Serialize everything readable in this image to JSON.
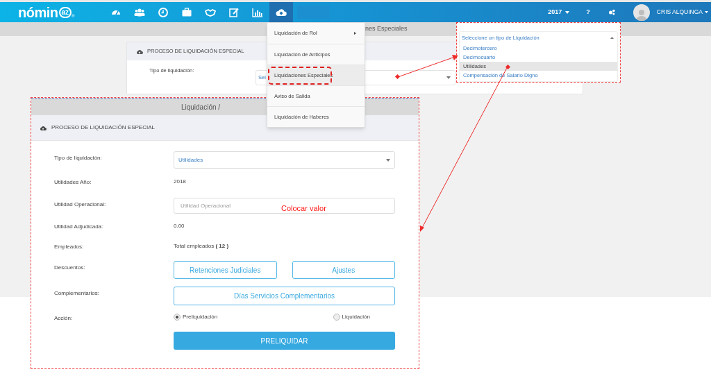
{
  "navbar": {
    "logo": "nómin",
    "logo_badge": "az",
    "logo_reg": "®",
    "nav_items": [
      {
        "kind": "gauge",
        "selected": false
      },
      {
        "kind": "users",
        "selected": false
      },
      {
        "kind": "clock",
        "selected": false
      },
      {
        "kind": "briefcase",
        "selected": false
      },
      {
        "kind": "handshake",
        "selected": false
      },
      {
        "kind": "edit",
        "selected": false
      },
      {
        "kind": "chart",
        "selected": false
      },
      {
        "kind": "cloud",
        "selected": true
      }
    ],
    "year": "2017",
    "help": "?",
    "user": "CRIS ALQUINGA"
  },
  "background_page": {
    "band_title": "nes Especiales",
    "panel_title": "PROCESO DE LIQUIDACIÓN ESPECIAL",
    "field_label": "Tipo de liquidación:",
    "select_value": "Sel"
  },
  "menu": {
    "items": [
      {
        "label": "Liquidación de Rol",
        "has_submenu": true,
        "selected": false
      },
      {
        "label": "Liquidación de Anticipos",
        "has_submenu": false,
        "selected": false
      },
      {
        "label": "Liquidaciones Especiales",
        "has_submenu": false,
        "selected": true
      },
      {
        "label": "Aviso de Salida",
        "has_submenu": false,
        "selected": false
      },
      {
        "label": "Liquidación de Haberes",
        "has_submenu": false,
        "selected": false
      }
    ]
  },
  "callout": {
    "placeholder": "Seleccione un tipo de Liquidación",
    "options": [
      {
        "label": "Decimotercero",
        "selected": false
      },
      {
        "label": "Decimocuarto",
        "selected": false
      },
      {
        "label": "Utilidades",
        "selected": true
      },
      {
        "label": "Compensación de Salario Digno",
        "selected": false
      }
    ]
  },
  "form": {
    "breadcrumb": "Liquidación /",
    "title": "PROCESO DE LIQUIDACIÓN ESPECIAL",
    "rows": [
      {
        "kind": "select",
        "label": "Tipo de liquidación:",
        "value": "Utilidades"
      },
      {
        "kind": "text",
        "label": "Utilidades Año:",
        "value": "2018"
      },
      {
        "kind": "input",
        "label": "Utilidad Operacional:",
        "placeholder": "Utilidad Operacional"
      },
      {
        "kind": "text",
        "label": "Utilidad Adjudicada:",
        "value": "0.00"
      },
      {
        "kind": "text",
        "label": "Empleados:",
        "value": "Total empleados **( 12 )**"
      },
      {
        "kind": "buttons",
        "label": "Descuentos:",
        "buttons": [
          "Retenciones Judiciales",
          "Ajustes"
        ]
      },
      {
        "kind": "buttons",
        "label": "Complementarios:",
        "buttons": [
          "Días Servicios Complementarios"
        ]
      },
      {
        "kind": "radio",
        "label": "Acción:",
        "options": [
          {
            "label": "Preliquidación",
            "selected": true
          },
          {
            "label": "Liquidación",
            "selected": false
          }
        ]
      },
      {
        "kind": "submit",
        "button": "PRELIQUIDAR"
      }
    ]
  },
  "annotation": "Colocar valor"
}
